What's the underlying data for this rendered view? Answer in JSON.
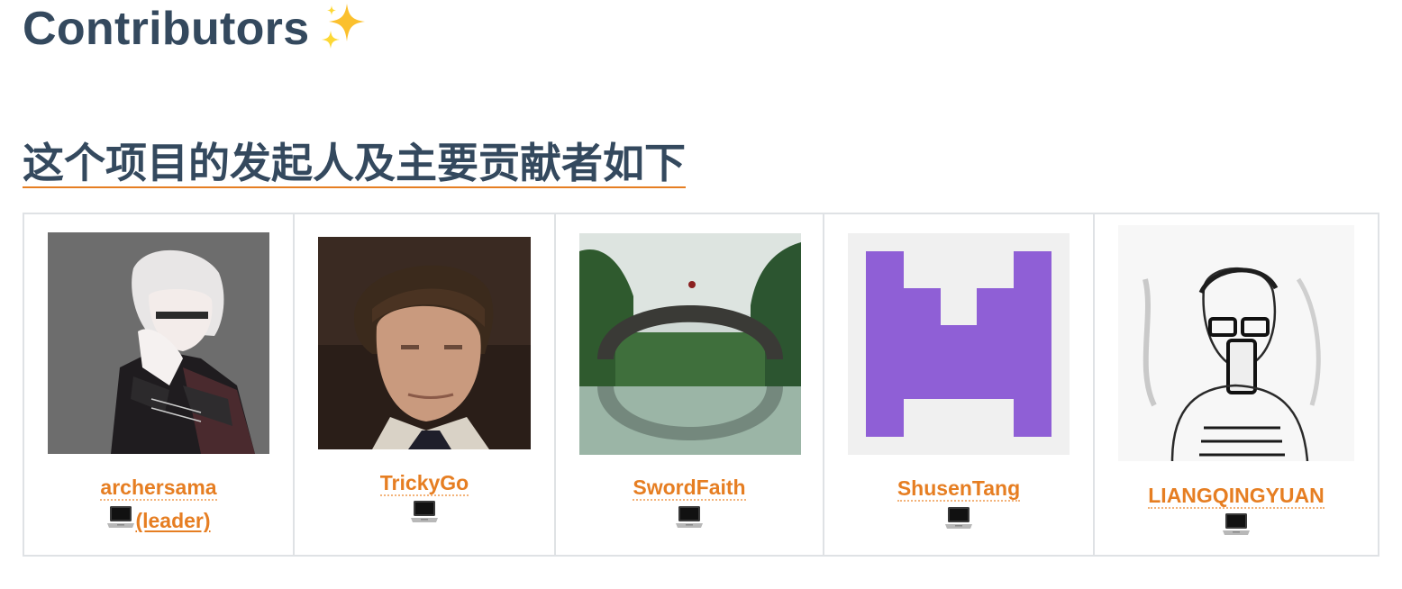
{
  "page": {
    "title": "Contributors",
    "title_emoji": "sparkles-icon",
    "subtitle": "这个项目的发起人及主要贡献者如下"
  },
  "colors": {
    "heading": "#34495e",
    "accent": "#e67e22",
    "border": "#dfe2e5"
  },
  "contributors": [
    {
      "name": "archersama",
      "avatar": "anime-portrait-avatar",
      "contribution_icon": "laptop-icon",
      "role": "(leader)"
    },
    {
      "name": "TrickyGo",
      "avatar": "man-portrait-avatar",
      "contribution_icon": "laptop-icon",
      "role": ""
    },
    {
      "name": "SwordFaith",
      "avatar": "arch-bridge-landscape-avatar",
      "contribution_icon": "laptop-icon",
      "role": ""
    },
    {
      "name": "ShusenTang",
      "avatar": "purple-identicon-avatar",
      "contribution_icon": "laptop-icon",
      "role": ""
    },
    {
      "name": "LIANGQINGYUAN",
      "avatar": "sketch-selfie-avatar",
      "contribution_icon": "laptop-icon",
      "role": ""
    }
  ]
}
